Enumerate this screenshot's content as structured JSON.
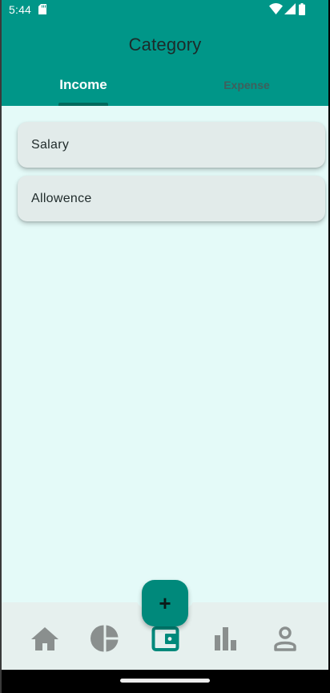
{
  "status_bar": {
    "time": "5:44"
  },
  "app_bar": {
    "title": "Category",
    "tabs": [
      {
        "label": "Income",
        "selected": true
      },
      {
        "label": "Expense",
        "selected": false
      }
    ]
  },
  "categories": [
    {
      "label": "Salary"
    },
    {
      "label": "Allowence"
    }
  ],
  "fab": {
    "icon": "plus-icon",
    "label": "+"
  },
  "bottom_nav": {
    "items": [
      {
        "icon": "home-icon"
      },
      {
        "icon": "pie-chart-icon"
      },
      {
        "icon": "wallet-icon",
        "active": true
      },
      {
        "icon": "bar-chart-icon"
      },
      {
        "icon": "profile-icon"
      }
    ]
  },
  "colors": {
    "primary": "#009688",
    "accent": "#00897b",
    "background": "#e4faf8",
    "inactive_icon": "#8a8f8e"
  }
}
